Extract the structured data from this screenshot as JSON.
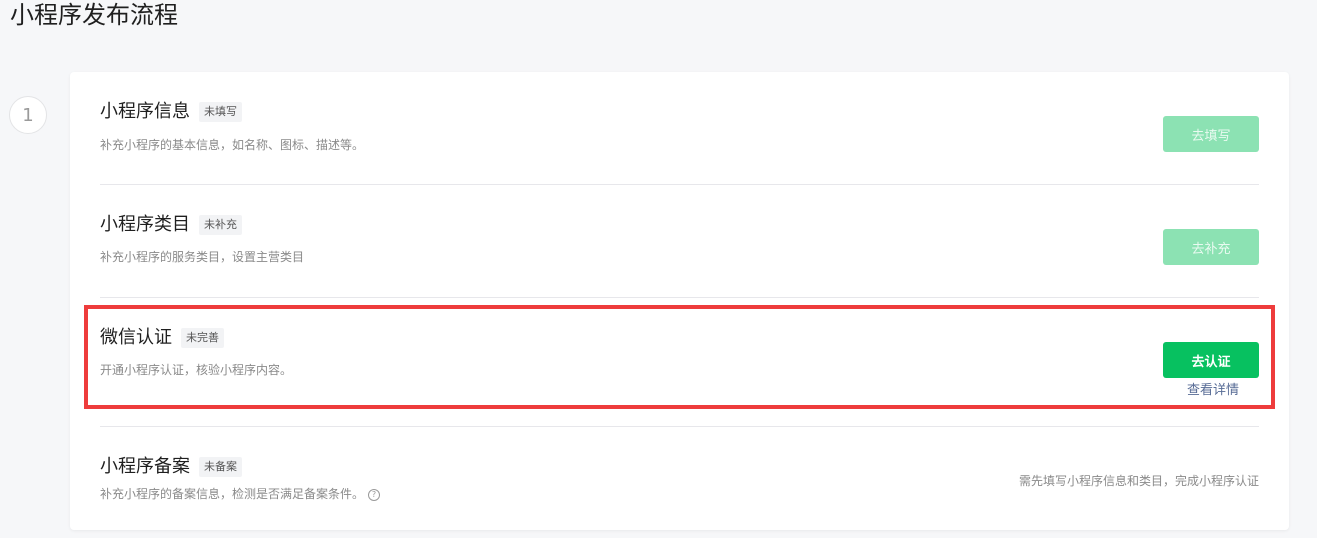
{
  "page": {
    "title": "小程序发布流程"
  },
  "step": {
    "number": "1"
  },
  "sections": [
    {
      "title": "小程序信息",
      "tag": "未填写",
      "desc": "补充小程序的基本信息，如名称、图标、描述等。",
      "button": "去填写",
      "button_state": "disabled"
    },
    {
      "title": "小程序类目",
      "tag": "未补充",
      "desc": "补充小程序的服务类目，设置主营类目",
      "button": "去补充",
      "button_state": "disabled"
    },
    {
      "title": "微信认证",
      "tag": "未完善",
      "desc": "开通小程序认证，核验小程序内容。",
      "button": "去认证",
      "button_state": "enabled",
      "link": "查看详情",
      "highlighted": true
    },
    {
      "title": "小程序备案",
      "tag": "未备案",
      "desc": "补充小程序的备案信息，检测是否满足备案条件。",
      "help_icon": "question-circle-icon",
      "notice": "需先填写小程序信息和类目，完成小程序认证"
    }
  ],
  "colors": {
    "primary_green": "#07c160",
    "disabled_green": "#8ce2b3",
    "link_blue": "#576b95",
    "highlight_red": "#ee3c3c"
  }
}
